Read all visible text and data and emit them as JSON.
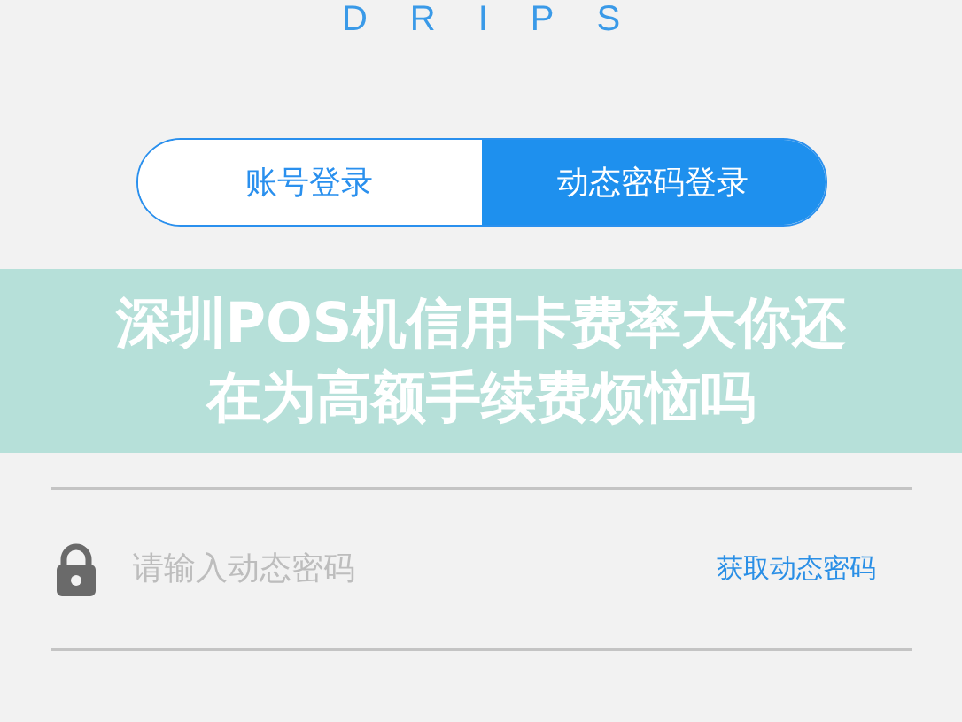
{
  "logo": "DRIPS",
  "tabs": [
    {
      "label": "账号登录",
      "selected": false
    },
    {
      "label": "动态密码登录",
      "selected": true
    }
  ],
  "fields": [
    {
      "placeholder": "请输入动态密码",
      "action": "获取动态密码"
    }
  ],
  "banner": {
    "lines": [
      "深圳POS机信用卡费率大你还",
      "在为高额手续费烦恼吗"
    ]
  }
}
